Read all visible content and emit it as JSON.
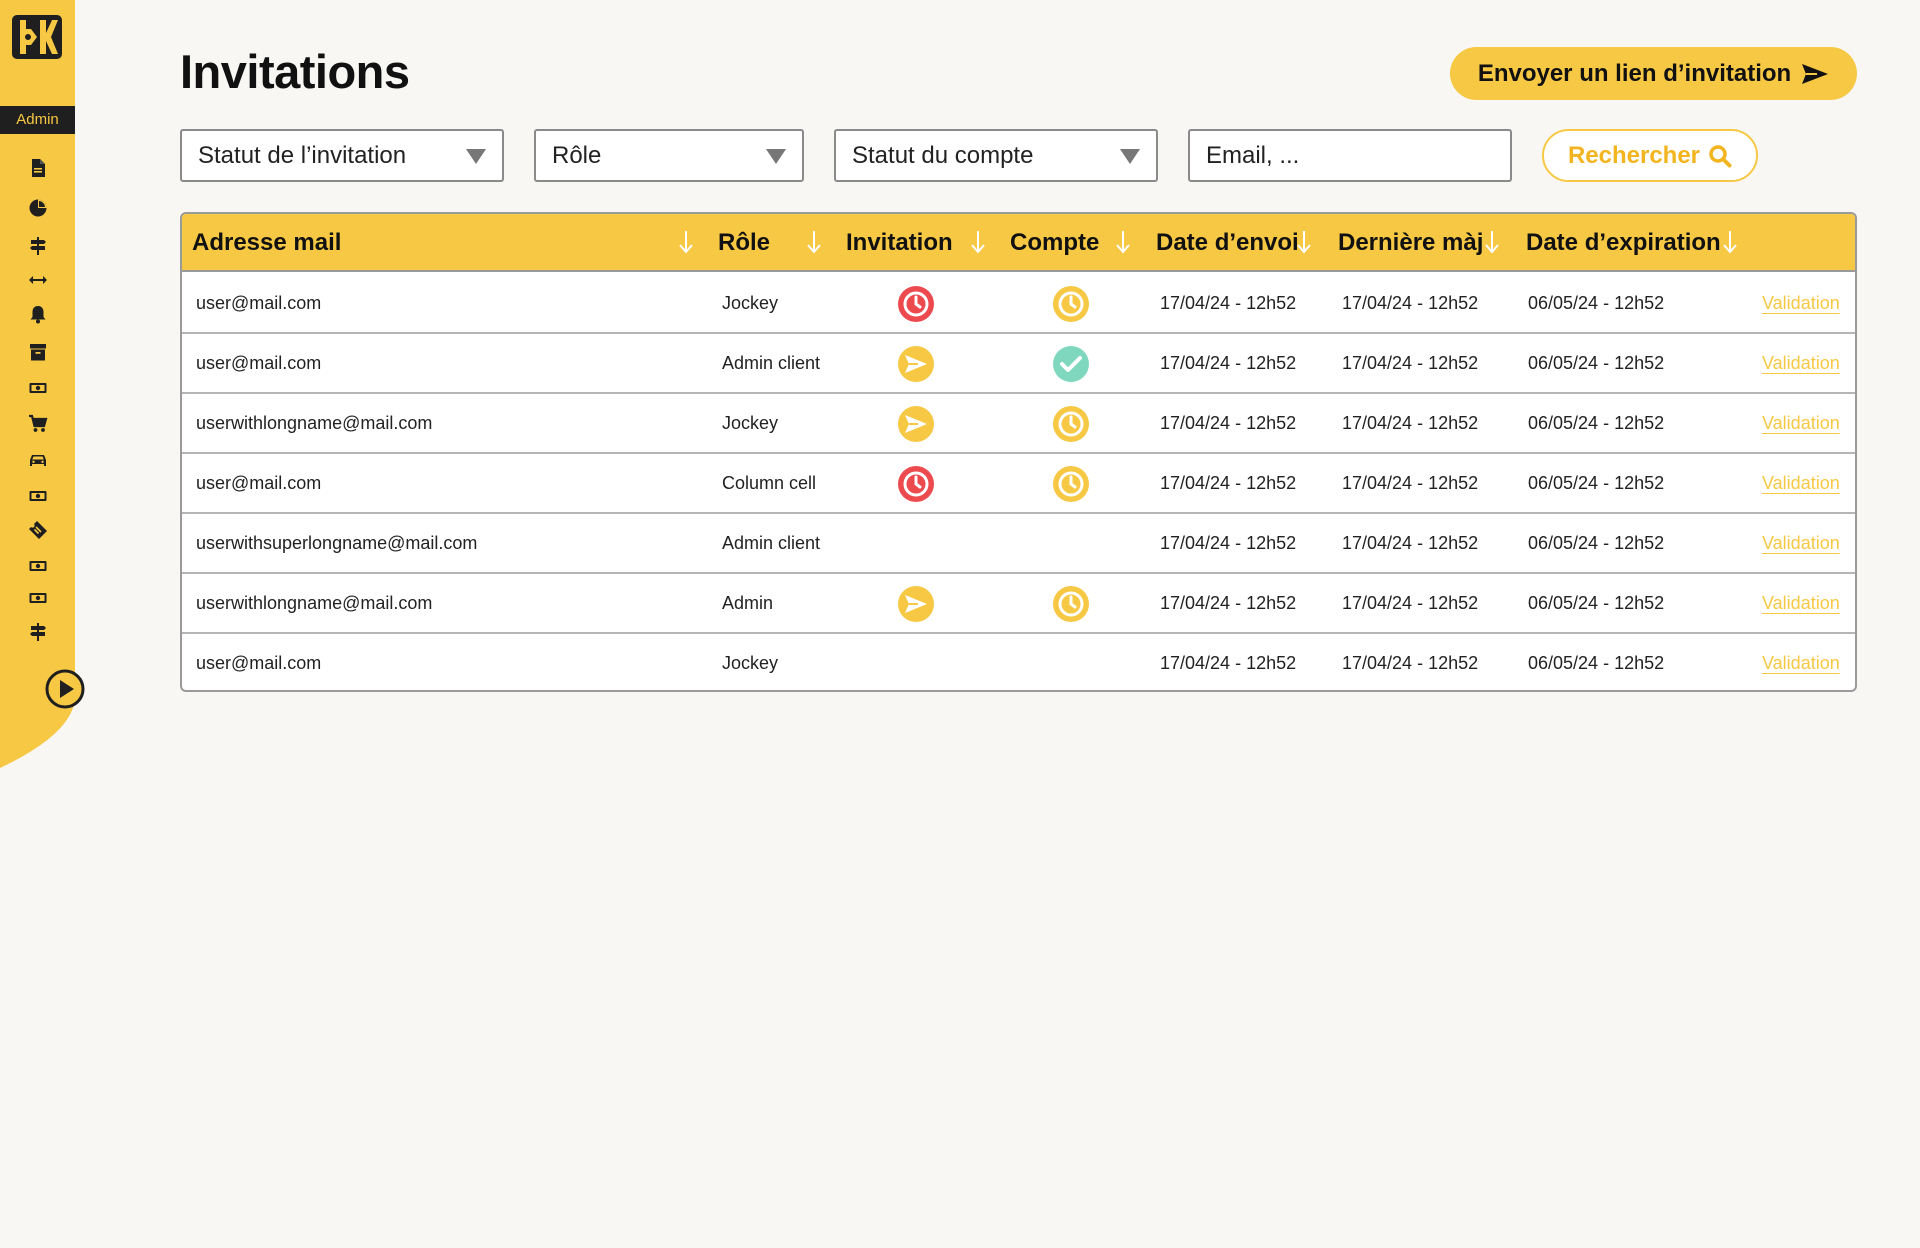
{
  "sidebar": {
    "role": "Admin",
    "items": [
      {
        "icon": "document-icon"
      },
      {
        "icon": "pie-chart-icon"
      },
      {
        "icon": "signpost-icon"
      },
      {
        "icon": "arrows-horizontal-icon"
      },
      {
        "icon": "bell-icon"
      },
      {
        "icon": "archive-icon"
      },
      {
        "icon": "banknote-icon"
      },
      {
        "icon": "cart-icon"
      },
      {
        "icon": "car-icon"
      },
      {
        "icon": "banknote-icon"
      },
      {
        "icon": "ticket-icon"
      },
      {
        "icon": "banknote-icon"
      },
      {
        "icon": "banknote-icon"
      },
      {
        "icon": "signpost-icon"
      }
    ]
  },
  "header": {
    "title": "Invitations",
    "invite_button": "Envoyer un lien d’invitation"
  },
  "filters": {
    "invitation_status": "Statut de l’invitation",
    "role": "Rôle",
    "account_status": "Statut du compte",
    "search_placeholder": "Email, ...",
    "search_button": "Rechercher"
  },
  "table": {
    "columns": [
      "Adresse mail",
      "Rôle",
      "Invitation",
      "Compte",
      "Date d’envoi",
      "Dernière màj",
      "Date d’expiration"
    ],
    "rows": [
      {
        "email": "user@mail.com",
        "role": "Jockey",
        "invitation": "expired",
        "account": "pending",
        "sent": "17/04/24 - 12h52",
        "updated": "17/04/24 - 12h52",
        "expires": "06/05/24 - 12h52",
        "action": "Validation"
      },
      {
        "email": "user@mail.com",
        "role": "Admin client",
        "invitation": "sent",
        "account": "validated",
        "sent": "17/04/24 - 12h52",
        "updated": "17/04/24 - 12h52",
        "expires": "06/05/24 - 12h52",
        "action": "Validation"
      },
      {
        "email": "userwithlongname@mail.com",
        "role": "Jockey",
        "invitation": "sent",
        "account": "pending",
        "sent": "17/04/24 - 12h52",
        "updated": "17/04/24 - 12h52",
        "expires": "06/05/24 - 12h52",
        "action": "Validation"
      },
      {
        "email": "user@mail.com",
        "role": "Column cell",
        "invitation": "expired",
        "account": "pending",
        "sent": "17/04/24 - 12h52",
        "updated": "17/04/24 - 12h52",
        "expires": "06/05/24 - 12h52",
        "action": "Validation"
      },
      {
        "email": "userwithsuperlongname@mail.com",
        "role": "Admin client",
        "invitation": "",
        "account": "",
        "sent": "17/04/24 - 12h52",
        "updated": "17/04/24 - 12h52",
        "expires": "06/05/24 - 12h52",
        "action": "Validation"
      },
      {
        "email": "userwithlongname@mail.com",
        "role": "Admin",
        "invitation": "sent",
        "account": "pending",
        "sent": "17/04/24 - 12h52",
        "updated": "17/04/24 - 12h52",
        "expires": "06/05/24 - 12h52",
        "action": "Validation"
      },
      {
        "email": "user@mail.com",
        "role": "Jockey",
        "invitation": "",
        "account": "",
        "sent": "17/04/24 - 12h52",
        "updated": "17/04/24 - 12h52",
        "expires": "06/05/24 - 12h52",
        "action": "Validation"
      }
    ]
  },
  "colors": {
    "accent": "#f7c843",
    "danger": "#ec4a4f",
    "success": "#7fd8be",
    "dark": "#1f1f1f"
  }
}
